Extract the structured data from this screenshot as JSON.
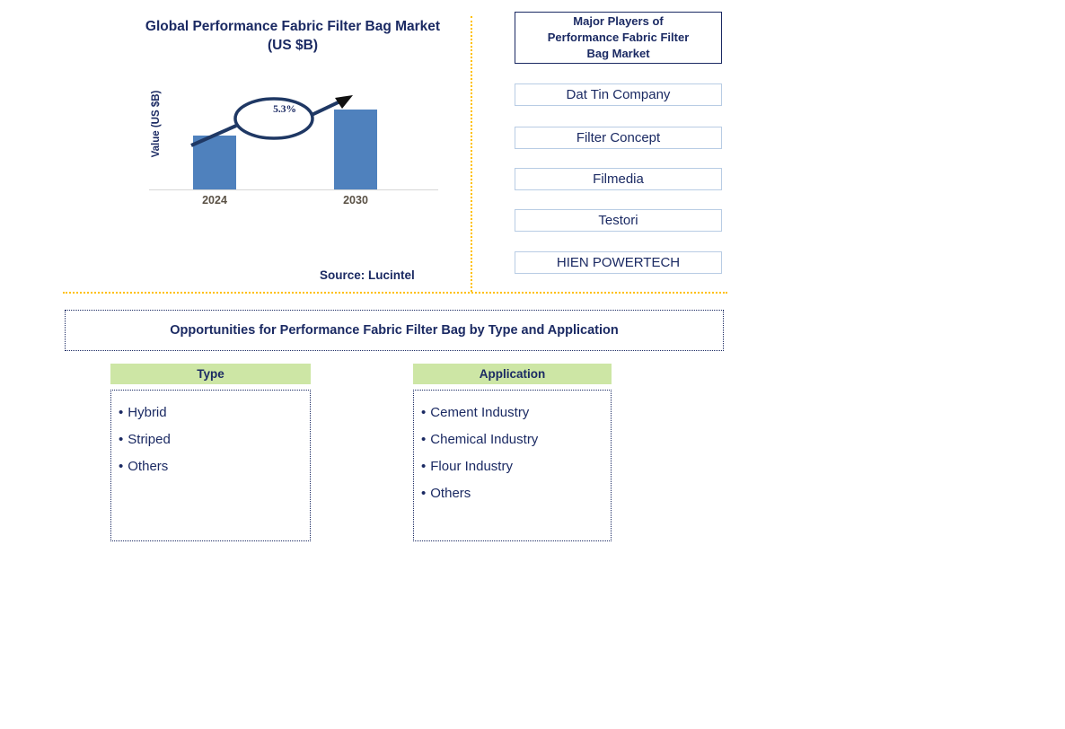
{
  "chart_panel": {
    "title_line1": "Global Performance Fabric Filter Bag Market",
    "title_line2": "(US $B)",
    "source": "Source: Lucintel"
  },
  "chart_data": {
    "type": "bar",
    "title": "Global Performance Fabric Filter Bag Market (US $B)",
    "xlabel": "",
    "ylabel": "Value (US $B)",
    "categories": [
      "2024",
      "2030"
    ],
    "values": [
      1.0,
      1.48
    ],
    "ylim": [
      0,
      1.7
    ],
    "grid": false,
    "legend": "none",
    "bar_color": "#4F81BD",
    "annotations": [
      {
        "label": "5.3%",
        "type": "cagr-callout-ellipse-with-arrow",
        "from": "2024",
        "to": "2030"
      }
    ]
  },
  "players_panel": {
    "header_line1": "Major Players of",
    "header_line2": "Performance Fabric Filter",
    "header_line3": "Bag Market",
    "items": [
      {
        "label": "Dat Tin Company"
      },
      {
        "label": "Filter Concept"
      },
      {
        "label": "Filmedia"
      },
      {
        "label": "Testori"
      },
      {
        "label": "HIEN POWERTECH"
      }
    ]
  },
  "opportunities": {
    "banner": "Opportunities for Performance Fabric Filter Bag by Type and Application",
    "columns": [
      {
        "header": "Type",
        "items": [
          "Hybrid",
          "Striped",
          "Others"
        ]
      },
      {
        "header": "Application",
        "items": [
          "Cement Industry",
          "Chemical Industry",
          "Flour Industry",
          "Others"
        ]
      }
    ]
  },
  "bullet": "•",
  "colors": {
    "navy": "#1B2A63",
    "bar_blue": "#4F81BD",
    "divider_amber": "#FFC000",
    "header_green": "#CDE6A5",
    "player_border": "#B8CCE4",
    "tick_gray": "#5A5145"
  }
}
